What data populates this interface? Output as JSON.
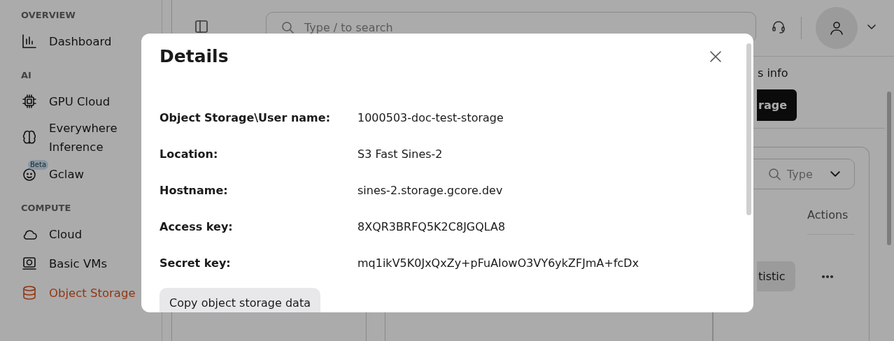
{
  "sidebar": {
    "sections": [
      {
        "heading": "OVERVIEW",
        "items": [
          {
            "label": "Dashboard",
            "selected": false
          }
        ]
      },
      {
        "heading": "AI",
        "items": [
          {
            "label": "GPU Cloud",
            "selected": false
          },
          {
            "label": "Everywhere Inference",
            "selected": false
          },
          {
            "label": "Gclaw",
            "badge": "Beta",
            "selected": false
          }
        ]
      },
      {
        "heading": "COMPUTE",
        "items": [
          {
            "label": "Cloud",
            "selected": false
          },
          {
            "label": "Basic VMs",
            "selected": false
          },
          {
            "label": "Object Storage",
            "selected": true
          }
        ]
      }
    ]
  },
  "header": {
    "search": {
      "placeholder": "Type / to search"
    }
  },
  "content": {
    "info_text": "s info",
    "primary_button": "rage",
    "filter": {
      "placeholder": "Type"
    },
    "columns": [
      "Actions"
    ],
    "row_button": "tistic"
  },
  "dialog": {
    "title": "Details",
    "fields": [
      {
        "label": "Object Storage\\User name:",
        "value": "1000503-doc-test-storage"
      },
      {
        "label": "Location:",
        "value": "S3 Fast Sines-2"
      },
      {
        "label": "Hostname:",
        "value": "sines-2.storage.gcore.dev"
      },
      {
        "label": "Access key:",
        "value": "8XQR3BRFQ5K2C8JGQLA8"
      },
      {
        "label": "Secret key:",
        "value": "mq1ikV5K0JxQxZy+pFuAIowO3VY6ykZFJmA+fcDx"
      }
    ],
    "button": "Copy object storage data"
  }
}
